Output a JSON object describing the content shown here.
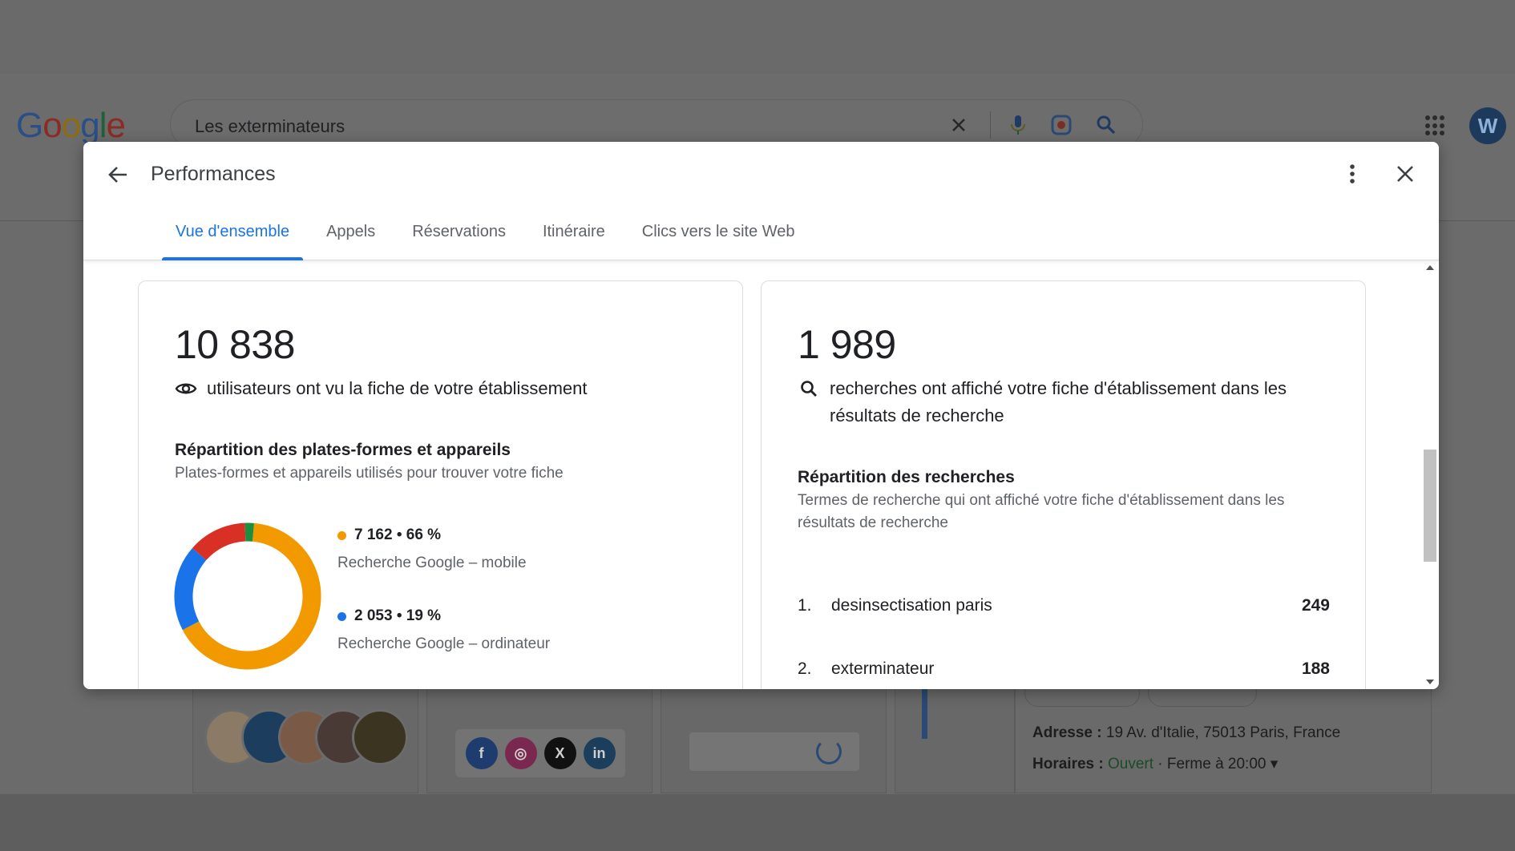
{
  "background": {
    "logo_letters": [
      "G",
      "o",
      "o",
      "g",
      "l",
      "e"
    ],
    "search_query": "Les exterminateurs",
    "user_initial": "W",
    "address_label": "Adresse :",
    "address_value": "19 Av. d'Italie, 75013 Paris, France",
    "hours_label": "Horaires :",
    "hours_status": "Ouvert",
    "hours_value": "· Ferme à 20:00",
    "social_icons": [
      "facebook-icon",
      "instagram-icon",
      "x-icon",
      "linkedin-icon"
    ]
  },
  "dialog": {
    "title": "Performances",
    "tabs": [
      {
        "label": "Vue d'ensemble",
        "active": true
      },
      {
        "label": "Appels",
        "active": false
      },
      {
        "label": "Réservations",
        "active": false
      },
      {
        "label": "Itinéraire",
        "active": false
      },
      {
        "label": "Clics vers le site Web",
        "active": false
      }
    ]
  },
  "views_card": {
    "total": "10 838",
    "total_caption": "utilisateurs ont vu la fiche de votre établissement",
    "section_title": "Répartition des plates-formes et appareils",
    "section_subtitle": "Plates-formes et appareils utilisés pour trouver votre fiche",
    "legend": [
      {
        "value_text": "7 162 • 66 %",
        "label": "Recherche Google – mobile",
        "color": "#f29900"
      },
      {
        "value_text": "2 053 • 19 %",
        "label": "Recherche Google – ordinateur",
        "color": "#1a73e8"
      }
    ]
  },
  "searches_card": {
    "total": "1 989",
    "total_caption": "recherches ont affiché votre fiche d'établissement dans les résultats de recherche",
    "section_title": "Répartition des recherches",
    "section_subtitle": "Termes de recherche qui ont affiché votre fiche d'établissement dans les résultats de recherche",
    "terms": [
      {
        "rank": "1.",
        "term": "desinsectisation paris",
        "count": "249"
      },
      {
        "rank": "2.",
        "term": "exterminateur",
        "count": "188"
      }
    ]
  },
  "chart_data": {
    "type": "pie",
    "categories": [
      "Recherche Google – mobile",
      "Recherche Google – ordinateur",
      "Autre (rouge)",
      "Autre (vert)"
    ],
    "values": [
      66,
      19,
      13,
      2
    ],
    "colors": [
      "#f29900",
      "#1a73e8",
      "#d93025",
      "#1e8e3e"
    ]
  }
}
